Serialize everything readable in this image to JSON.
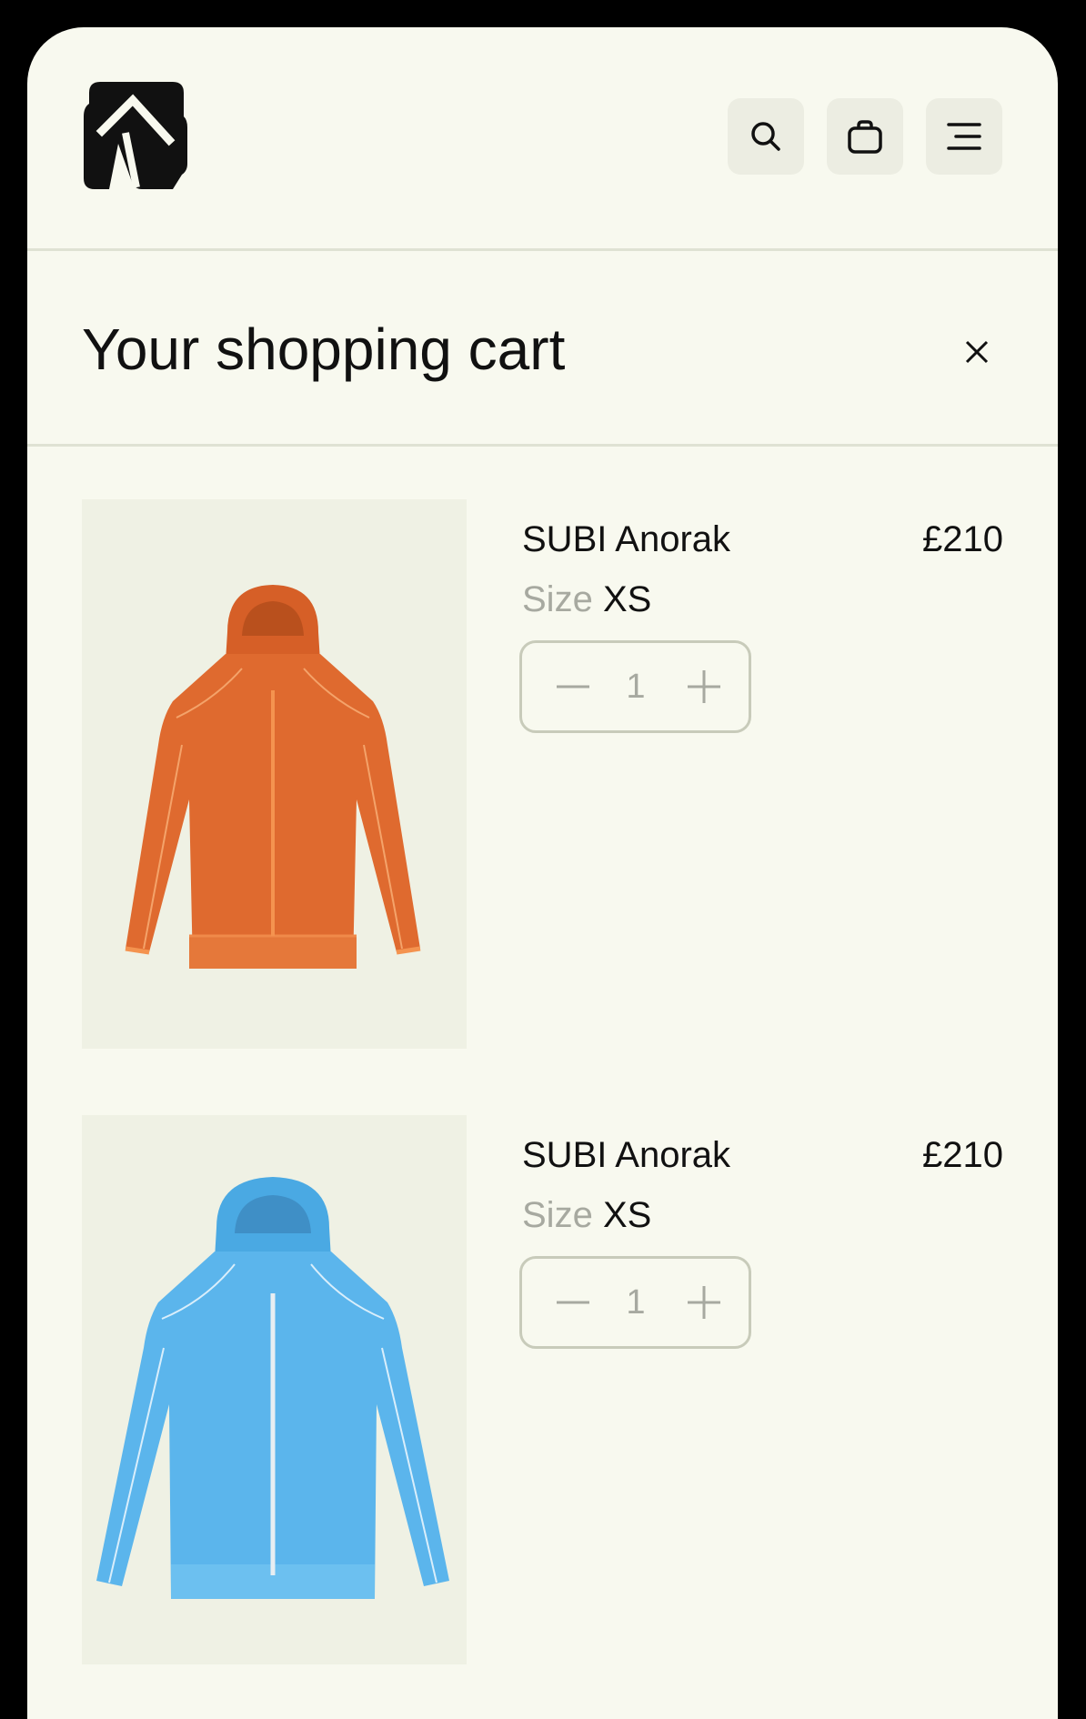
{
  "header": {
    "logo_icon": "brand-logo-icon",
    "actions": [
      {
        "icon": "search-icon"
      },
      {
        "icon": "shopping-bag-icon"
      },
      {
        "icon": "menu-icon"
      }
    ]
  },
  "cart": {
    "title": "Your shopping cart",
    "close_icon": "close-icon",
    "items": [
      {
        "name": "SUBI Anorak",
        "price": "£210",
        "size_label": "Size",
        "size_value": "XS",
        "quantity": "1",
        "image_icon": "orange-anorak-image",
        "color": "#e0672d"
      },
      {
        "name": "SUBI Anorak",
        "price": "£210",
        "size_label": "Size",
        "size_value": "XS",
        "quantity": "1",
        "image_icon": "blue-anorak-image",
        "color": "#5bb5ec"
      }
    ]
  },
  "colors": {
    "background": "#f8f9ef",
    "divider": "#dfe2d3",
    "icon_button_bg": "#ecede2",
    "muted_text": "#a7a9a0",
    "text": "#111111"
  }
}
